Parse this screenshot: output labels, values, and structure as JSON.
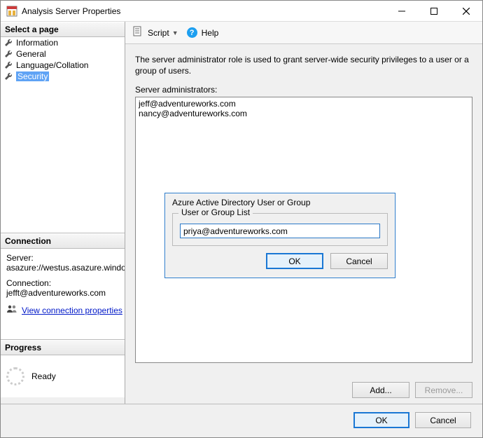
{
  "window": {
    "title": "Analysis Server Properties"
  },
  "sidebar": {
    "select_page_header": "Select a page",
    "pages": [
      {
        "label": "Information"
      },
      {
        "label": "General"
      },
      {
        "label": "Language/Collation"
      },
      {
        "label": "Security"
      }
    ],
    "connection_header": "Connection",
    "server_label": "Server:",
    "server_value": "asazure://westus.asazure.windows",
    "connection_label": "Connection:",
    "connection_value": "jefft@adventureworks.com",
    "view_connection_link": "View connection properties",
    "progress_header": "Progress",
    "progress_status": "Ready"
  },
  "toolbar": {
    "script_label": "Script",
    "help_label": "Help"
  },
  "main": {
    "description": "The server administrator role is used to grant server-wide security privileges to a user or a group of users.",
    "admin_list_label": "Server administrators:",
    "admins": [
      "jeff@adventureworks.com",
      "nancy@adventureworks.com"
    ],
    "add_label": "Add...",
    "remove_label": "Remove..."
  },
  "popup": {
    "title": "Azure Active Directory User or Group",
    "group_legend": "User or Group List",
    "input_value": "priya@adventureworks.com",
    "ok_label": "OK",
    "cancel_label": "Cancel"
  },
  "footer": {
    "ok_label": "OK",
    "cancel_label": "Cancel"
  }
}
